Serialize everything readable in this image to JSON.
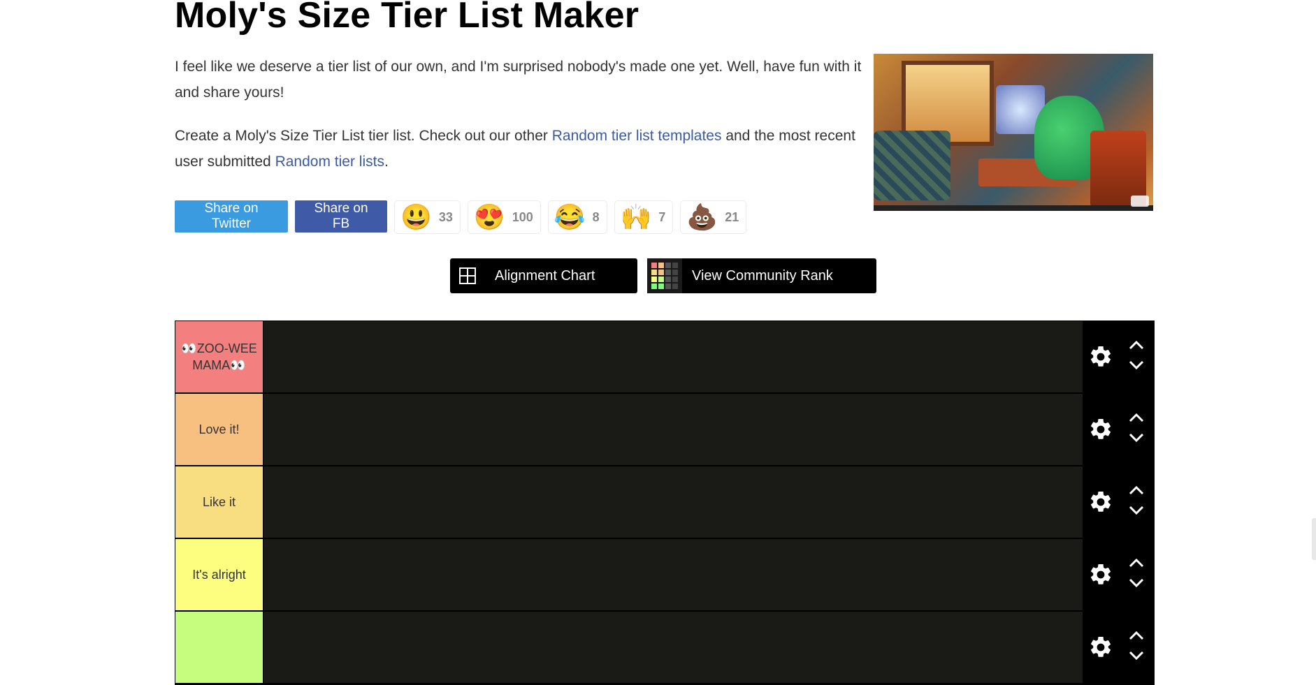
{
  "page": {
    "title": "Moly's Size Tier List Maker",
    "intro": "I feel like we deserve a tier list of our own, and I'm surprised nobody's made one yet. Well, have fun with it and share yours!",
    "create_prefix": "Create a Moly's Size Tier List tier list. Check out our other ",
    "templates_link": "Random tier list templates",
    "create_middle": " and the most recent user submitted ",
    "lists_link": "Random tier lists",
    "create_suffix": "."
  },
  "share": {
    "twitter": "Share on Twitter",
    "facebook": "Share on FB"
  },
  "reactions": [
    {
      "emoji": "😃",
      "count": "33"
    },
    {
      "emoji": "😍",
      "count": "100"
    },
    {
      "emoji": "😂",
      "count": "8"
    },
    {
      "emoji": "🙌",
      "count": "7"
    },
    {
      "emoji": "💩",
      "count": "21"
    }
  ],
  "actions": {
    "alignment": "Alignment Chart",
    "community": "View Community Rank"
  },
  "tiers": [
    {
      "label": "👀ZOO-WEE MAMA👀",
      "color": "#f47f7f"
    },
    {
      "label": "Love it!",
      "color": "#f7bf80"
    },
    {
      "label": "Like it",
      "color": "#f8de80"
    },
    {
      "label": "It's alright",
      "color": "#fdfd7f"
    },
    {
      "label": "",
      "color": "#c6fd7f"
    }
  ],
  "colors": {
    "twitter": "#3a9be0",
    "facebook": "#3f5ba8",
    "link": "#3b5aa3",
    "tier_bg": "#1a1a17"
  },
  "icons": {
    "alignment": "grid-icon",
    "community": "heatmap-icon",
    "tier_settings": "gear-icon",
    "move_up": "chevron-up-icon",
    "move_down": "chevron-down-icon"
  }
}
